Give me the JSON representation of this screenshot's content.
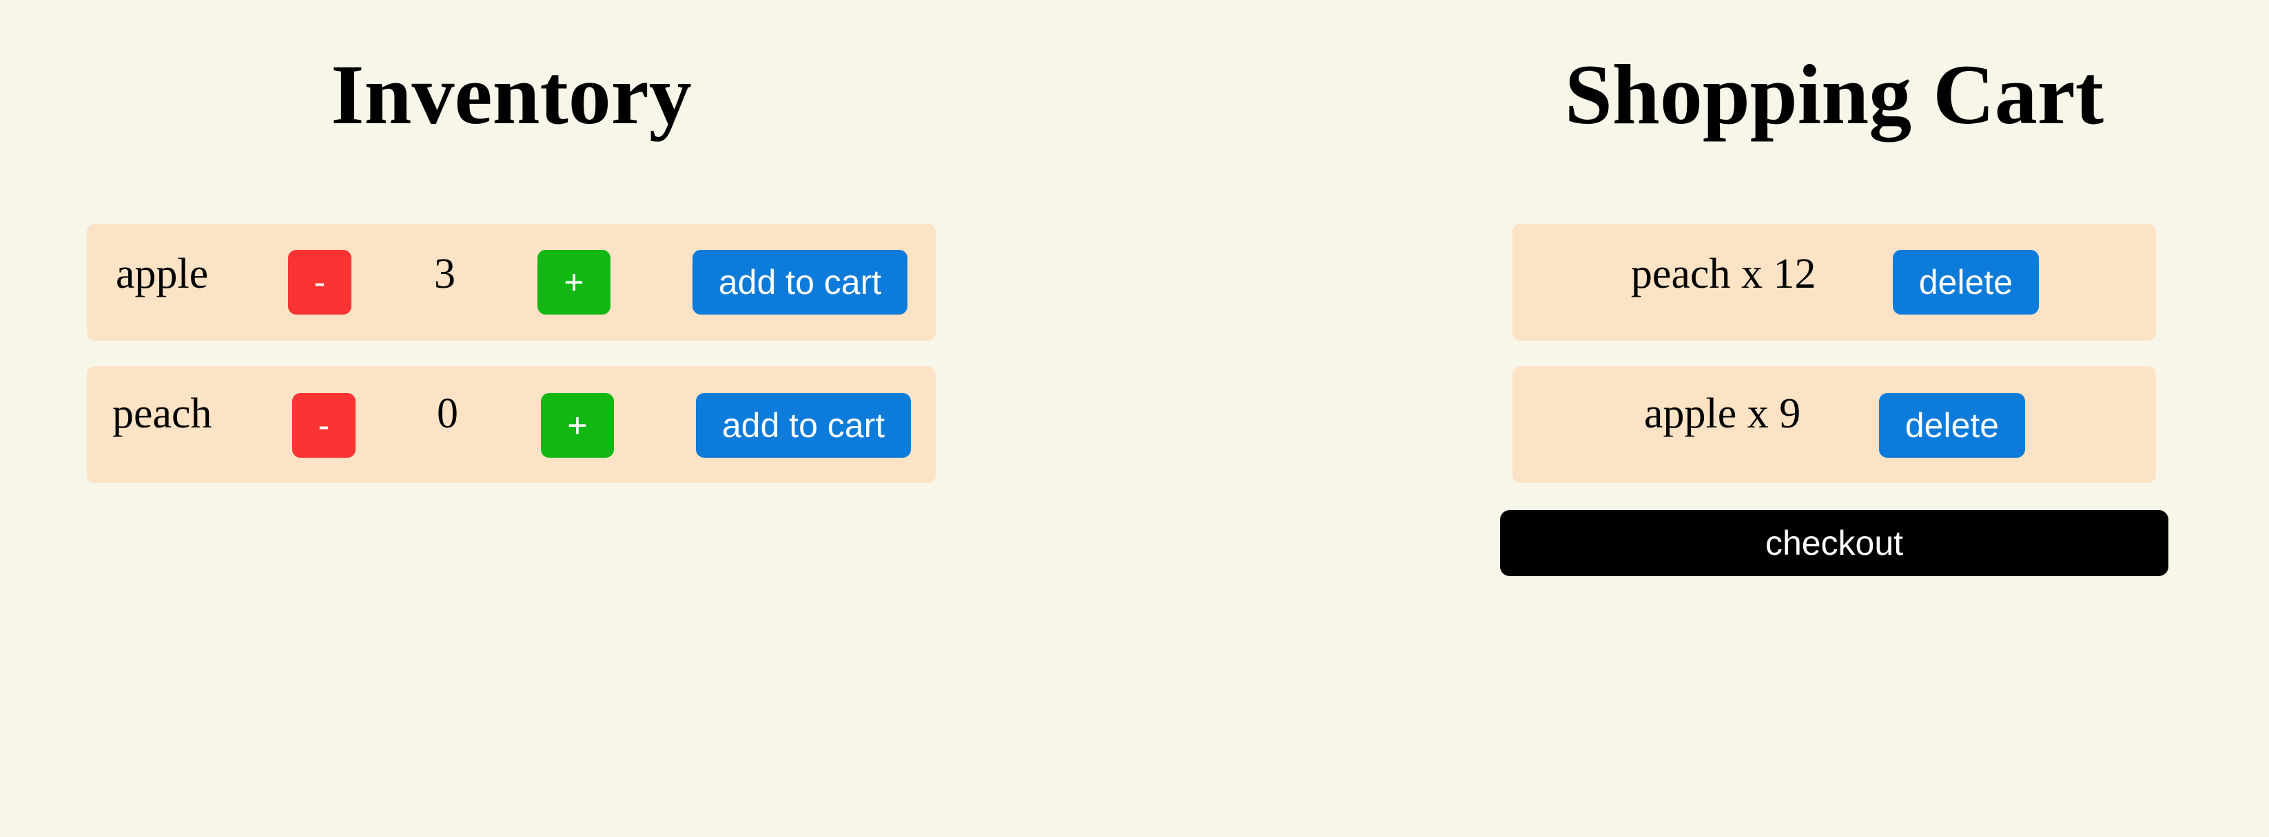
{
  "inventory": {
    "title": "Inventory",
    "items": [
      {
        "name": "apple",
        "quantity": "3",
        "minus_label": "-",
        "plus_label": "+",
        "add_label": "add to cart"
      },
      {
        "name": "peach",
        "quantity": "0",
        "minus_label": "-",
        "plus_label": "+",
        "add_label": "add to cart"
      }
    ]
  },
  "cart": {
    "title": "Shopping Cart",
    "items": [
      {
        "label": "peach x 12",
        "delete_label": "delete"
      },
      {
        "label": "apple x 9",
        "delete_label": "delete"
      }
    ],
    "checkout_label": "checkout"
  },
  "colors": {
    "background": "#f8f6e9",
    "row_background": "#fde3c5",
    "minus_button": "#fb3333",
    "plus_button": "#12b714",
    "action_button": "#0c7bd9",
    "checkout_button": "#000000"
  }
}
